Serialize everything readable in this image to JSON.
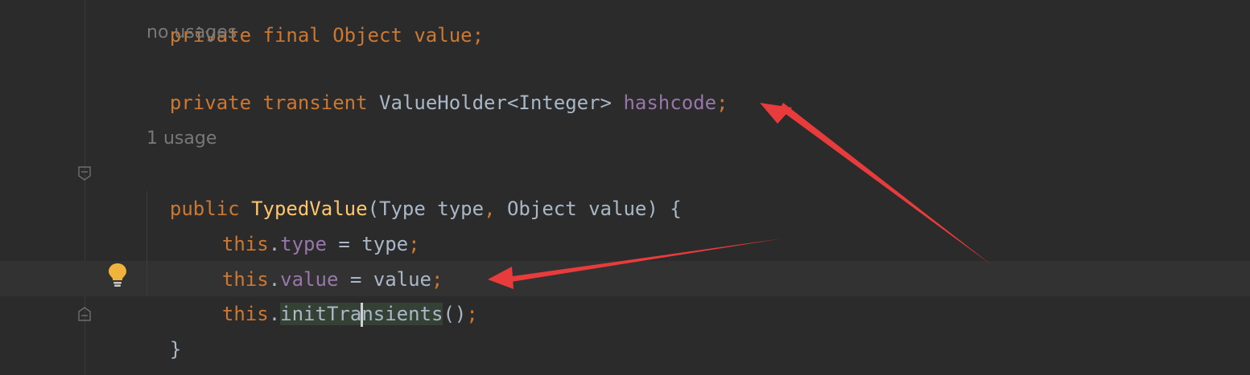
{
  "editor": {
    "line_top_partial": "private final Object value;",
    "inlay_no_usages": "no usages",
    "line_field": {
      "kw1": "private",
      "kw2": "transient",
      "type": "ValueHolder<Integer>",
      "name": "hashcode",
      "semi": ";"
    },
    "inlay_one_usage": "1 usage",
    "line_ctor": {
      "kw": "public",
      "name": "TypedValue",
      "params_start": "(Type type",
      "comma": ",",
      "params_end": " Object value) {"
    },
    "line_type": {
      "this": "this",
      "dot": ".",
      "field": "type",
      "rest": " = type",
      "semi": ";"
    },
    "line_value": {
      "this": "this",
      "dot": ".",
      "field": "value",
      "rest": " = value",
      "semi": ";"
    },
    "line_call": {
      "this": "this",
      "dot": ".",
      "method_a": "initTra",
      "method_b": "nsients",
      "parens": "()",
      "semi": ";"
    },
    "closing_brace": "}"
  },
  "colors": {
    "background": "#2b2b2b",
    "keyword": "#cc7832",
    "field": "#9876aa",
    "method_decl": "#ffc66d",
    "text": "#a9b7c6",
    "annotation_arrow": "#e83b3b",
    "bulb": "#f0b43c"
  },
  "icons": [
    "fold-start-icon",
    "fold-end-icon",
    "lightbulb-icon"
  ]
}
